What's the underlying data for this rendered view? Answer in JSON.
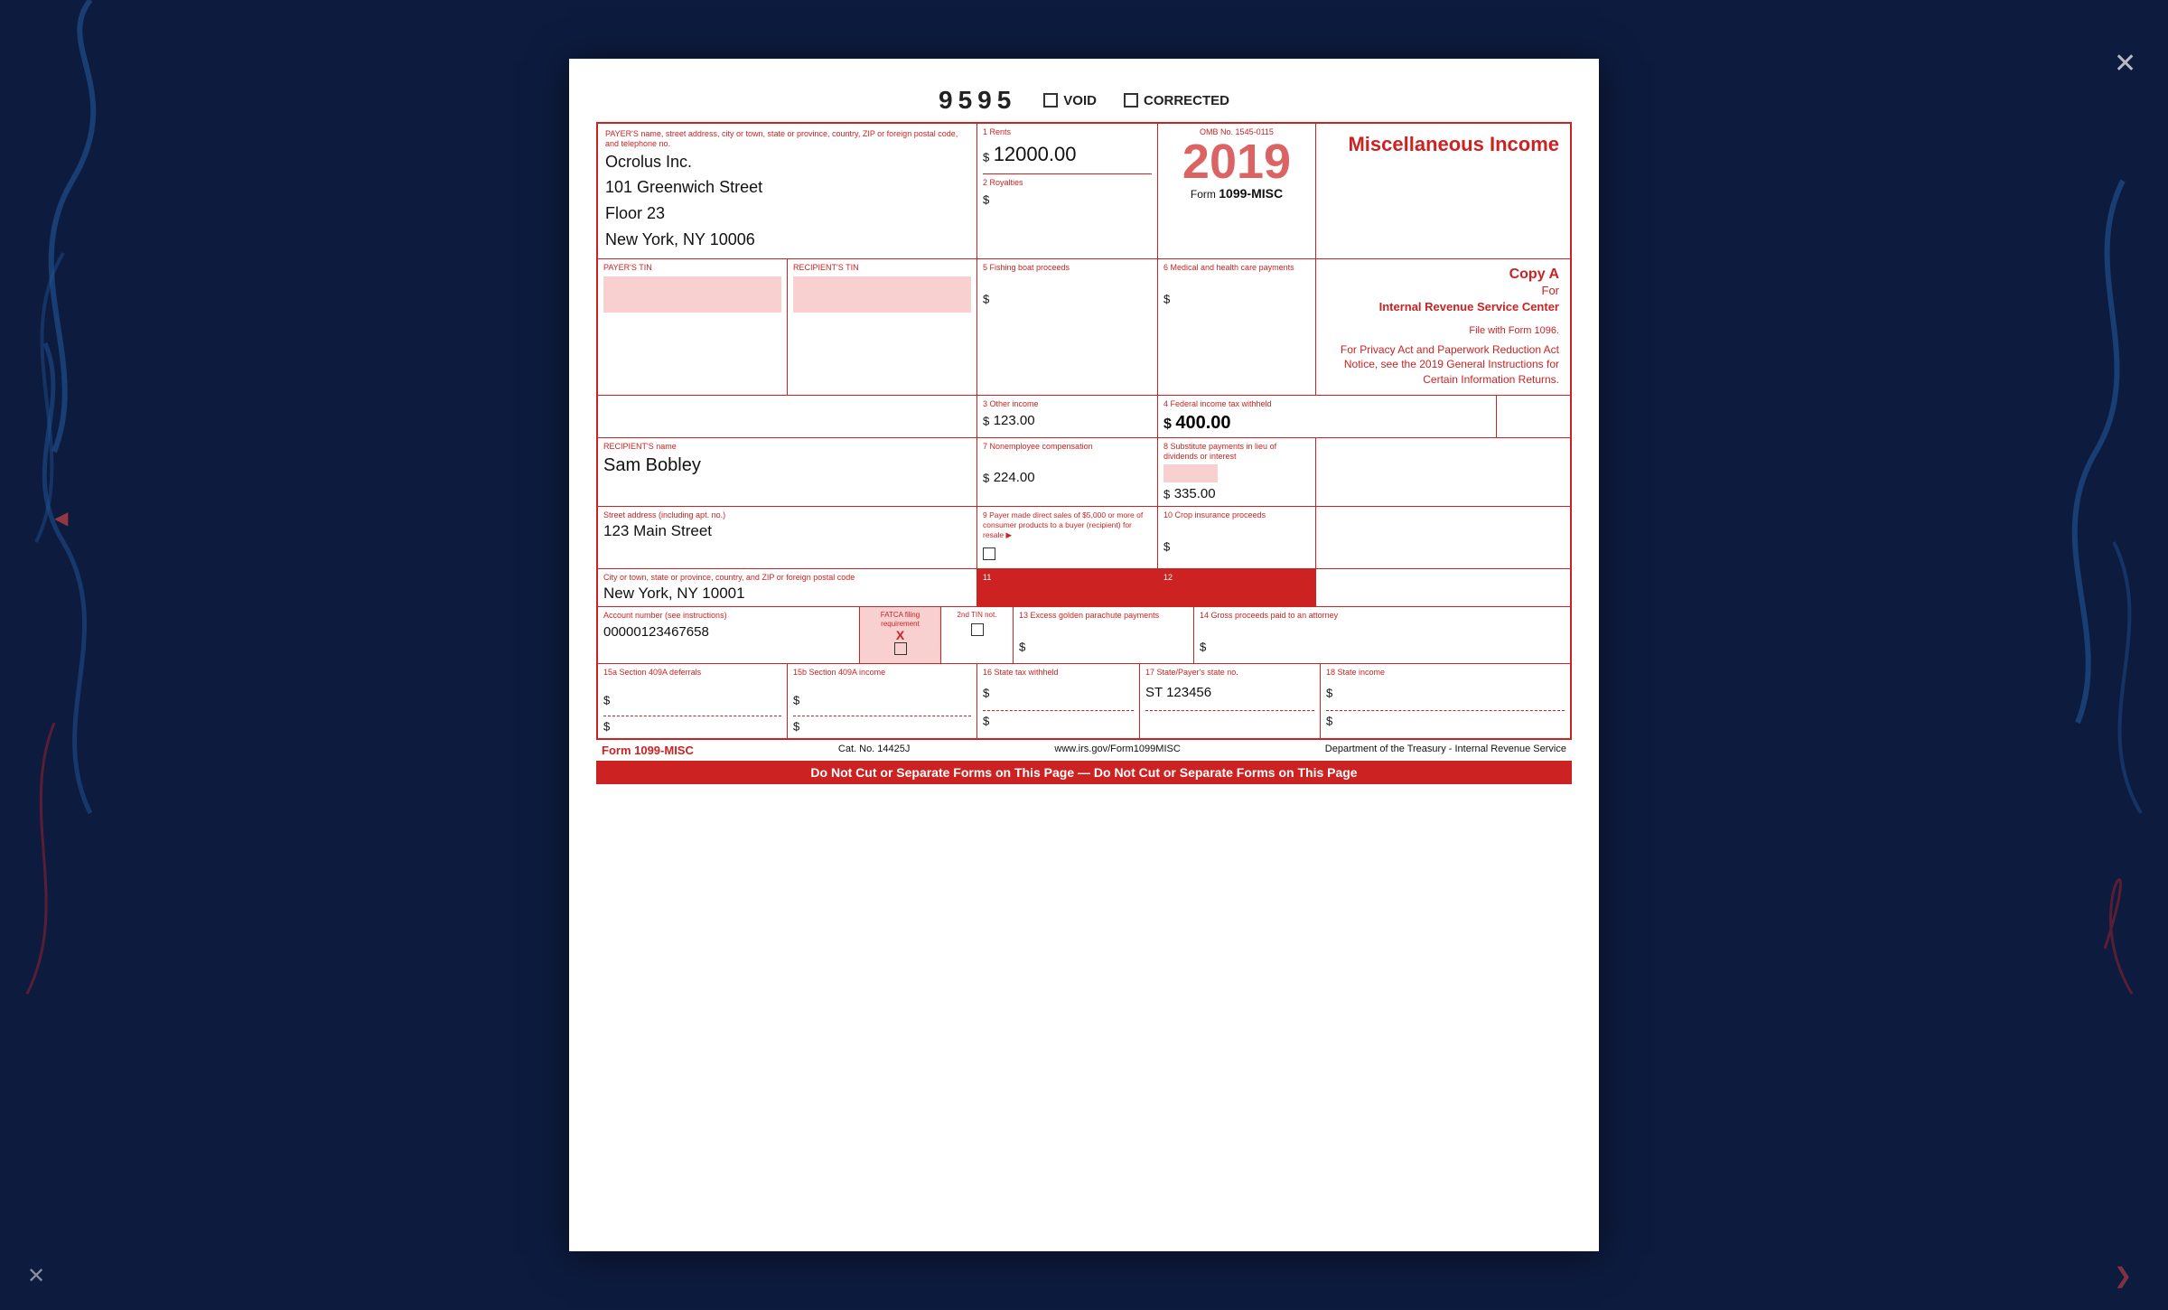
{
  "background": "#0d1b3e",
  "header": {
    "form_number": "9595",
    "void_label": "VOID",
    "corrected_label": "CORRECTED"
  },
  "form": {
    "title": "Miscellaneous Income",
    "year": "2019",
    "form_name": "1099-MISC",
    "omb": "OMB No. 1545-0115",
    "copy_a": "Copy A",
    "copy_for": "For",
    "copy_center": "Internal Revenue Service Center",
    "file_with": "File with Form 1096.",
    "privacy_notice": "For Privacy Act and Paperwork Reduction Act Notice, see the 2019 General Instructions for Certain Information Returns.",
    "payer_label": "PAYER'S name, street address, city or town, state or province, country, ZIP or foreign postal code, and telephone no.",
    "payer_name": "Ocrolus Inc.",
    "payer_address1": "101 Greenwich Street",
    "payer_address2": "Floor 23",
    "payer_address3": "New York, NY 10006",
    "box1_label": "1 Rents",
    "box1_value": "12000.00",
    "box2_label": "2 Royalties",
    "box2_value": "",
    "box3_label": "3 Other income",
    "box3_value": "123.00",
    "box4_label": "4 Federal income tax withheld",
    "box4_value": "400.00",
    "payers_tin_label": "PAYER'S TIN",
    "recipients_tin_label": "RECIPIENT'S TIN",
    "box5_label": "5 Fishing boat proceeds",
    "box5_value": "",
    "box6_label": "6 Medical and health care payments",
    "box6_value": "",
    "recipient_name_label": "RECIPIENT'S name",
    "recipient_name": "Sam Bobley",
    "box7_label": "7 Nonemployee compensation",
    "box7_value": "224.00",
    "box8_label": "8 Substitute payments in lieu of dividends or interest",
    "box8_value": "335.00",
    "street_address_label": "Street address (including apt. no.)",
    "street_address": "123 Main Street",
    "box9_label": "9 Payer made direct sales of $5,000 or more of consumer products to a buyer (recipient) for resale ▶",
    "box9_checkbox": false,
    "box10_label": "10 Crop insurance proceeds",
    "box10_value": "",
    "city_label": "City or town, state or province, country, and ZIP or foreign postal code",
    "city_value": "New York, NY 10001",
    "box11_label": "11",
    "box11_value": "",
    "box12_label": "12",
    "box12_value": "",
    "account_label": "Account number (see instructions)",
    "account_value": "00000123467658",
    "fatca_label": "FATCA filing requirement",
    "fatca_checked": true,
    "tin_not_label": "2nd TIN not.",
    "tin_not_checkbox": false,
    "box13_label": "13 Excess golden parachute payments",
    "box13_value": "",
    "box14_label": "14 Gross proceeds paid to an attorney",
    "box14_value": "",
    "box15a_label": "15a Section 409A deferrals",
    "box15a_value": "",
    "box15b_label": "15b Section 409A income",
    "box15b_value": "",
    "box16_label": "16 State tax withheld",
    "box16_value": "",
    "box16_value2": "",
    "box17_label": "17 State/Payer's state no.",
    "box17_value": "ST 123456",
    "box17_value2": "",
    "box18_label": "18 State income",
    "box18_value": "",
    "box18_value2": "",
    "footer_form": "Form 1099-MISC",
    "footer_cat": "Cat. No. 14425J",
    "footer_url": "www.irs.gov/Form1099MISC",
    "footer_dept": "Department of the Treasury - Internal Revenue Service",
    "do_not_cut": "Do Not Cut or Separate Forms on This Page — Do Not Cut or Separate Forms on This Page"
  }
}
